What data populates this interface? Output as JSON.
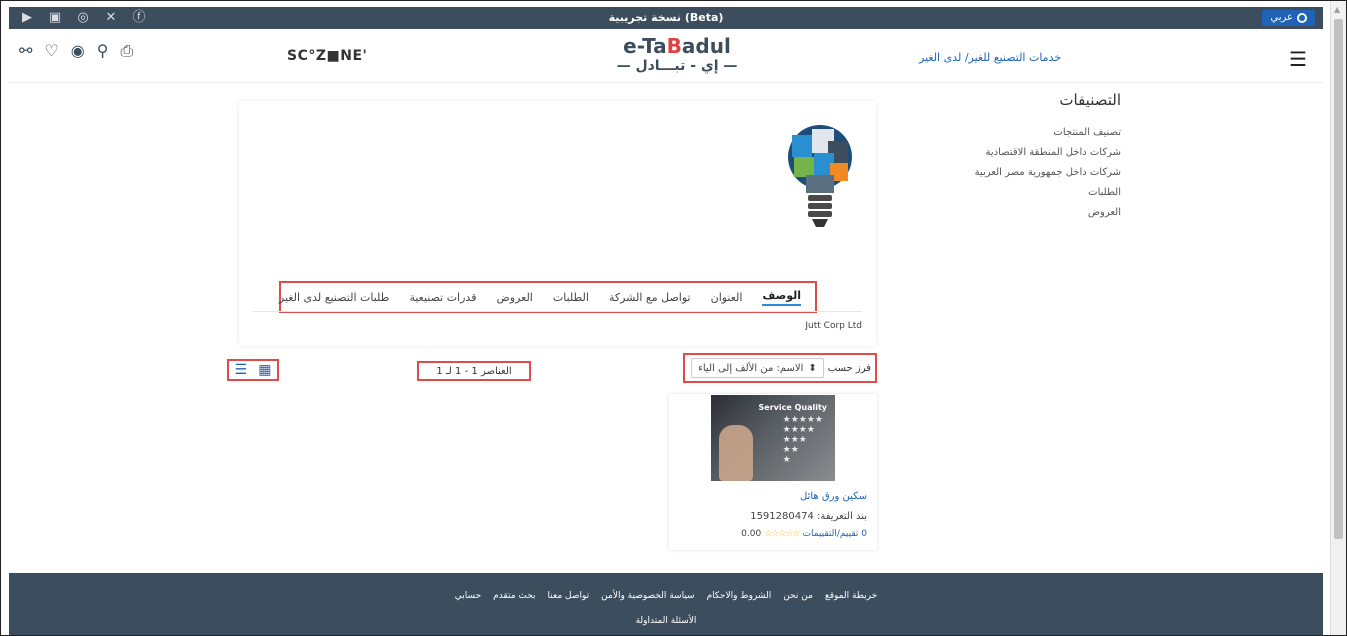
{
  "topbar": {
    "socials": [
      "youtube-icon",
      "linkedin-icon",
      "instagram-icon",
      "x-icon",
      "facebook-icon"
    ],
    "beta_label": "نسخة تجريبية (Beta)",
    "lang_label": "عربي"
  },
  "header": {
    "partner_logo": "SC°Z■NE'",
    "brand_en_pre": "e-Ta",
    "brand_en_mid": "B",
    "brand_en_post": "adul",
    "brand_ar": "— إي - تبـــادل —",
    "service_link": "خدمات التصنيع للغير/ لدى الغير"
  },
  "sidebar": {
    "title": "التصنيفات",
    "items": [
      "تصنيف المنتجات",
      "شركات داخل المنطقة الاقتصادية",
      "شركات داخل جمهورية مصر العربية",
      "الطلبات",
      "العروض"
    ]
  },
  "tabs": [
    "الوصف",
    "العنوان",
    "تواصل مع الشركة",
    "الطلبات",
    "العروض",
    "قدرات تصنيعية",
    "طلبات التصنيع لدى الغير"
  ],
  "company_name": "Jutt Corp Ltd",
  "toolbar": {
    "count_text": "العناصر 1 - 1 لـ 1",
    "sort_label": "فرز حسب",
    "sort_value": "الاسم: من الألف إلى الياء"
  },
  "product": {
    "image_title": "Service Quality",
    "name": "سكين ورق هائل",
    "sku": "بند التعريفة: 1591280474",
    "score": "0.00",
    "reviews": "0 تقييم/التقييمات",
    "stars": "☆☆☆☆☆"
  },
  "footer": {
    "links": [
      "خريطة الموقع",
      "من نحن",
      "الشروط والاحكام",
      "سياسة الخصوصية والأمن",
      "تواصل معنا",
      "بحث متقدم",
      "حسابي"
    ],
    "faq": "الأسئلة المتداولة"
  },
  "colors": {
    "navy": "#3c4d5e",
    "accent_blue": "#1e63b5",
    "highlight_red": "#e04b4b"
  }
}
